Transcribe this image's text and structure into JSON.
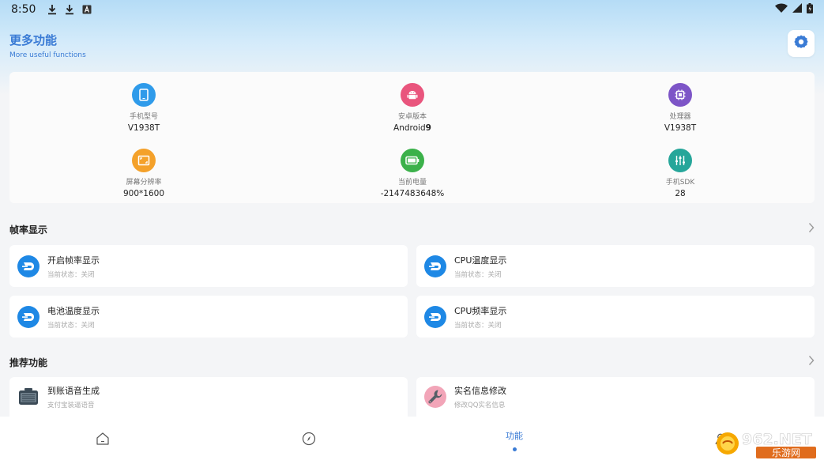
{
  "status_bar": {
    "time": "8:50"
  },
  "header": {
    "title": "更多功能",
    "subtitle": "More useful functions"
  },
  "info": {
    "items": [
      {
        "label": "手机型号",
        "value": "V1938T",
        "color": "#2f9bea",
        "icon": "phone-icon"
      },
      {
        "label": "安卓版本",
        "value": "Android",
        "value_bold": "9",
        "color": "#e9557d",
        "icon": "android-icon"
      },
      {
        "label": "处理器",
        "value": "V1938T",
        "color": "#7d55c7",
        "icon": "chip-icon"
      },
      {
        "label": "屏幕分辨率",
        "value": "900*1600",
        "color": "#f4a12a",
        "icon": "screen-resolution-icon"
      },
      {
        "label": "当前电量",
        "value": "-2147483648%",
        "color": "#3bb14a",
        "icon": "battery-icon"
      },
      {
        "label": "手机SDK",
        "value": "28",
        "color": "#26a69a",
        "icon": "sliders-icon"
      }
    ]
  },
  "sections": {
    "frame": {
      "title": "帧率显示",
      "cards": [
        {
          "title": "开启帧率显示",
          "sub": "当前状态：关闭"
        },
        {
          "title": "CPU温度显示",
          "sub": "当前状态：关闭"
        },
        {
          "title": "电池温度显示",
          "sub": "当前状态：关闭"
        },
        {
          "title": "CPU频率显示",
          "sub": "当前状态：关闭"
        }
      ]
    },
    "recommend": {
      "title": "推荐功能",
      "cards": [
        {
          "title": "到账语音生成",
          "sub": "支付宝装逼语音"
        },
        {
          "title": "实名信息修改",
          "sub": "修改QQ实名信息"
        }
      ]
    }
  },
  "bottom_nav": {
    "active_label": "功能"
  },
  "watermark": {
    "text": "962.NET",
    "sub": "乐游网"
  },
  "colors": {
    "accent": "#3a7bd5",
    "dash_blue": "#1e88e5"
  }
}
